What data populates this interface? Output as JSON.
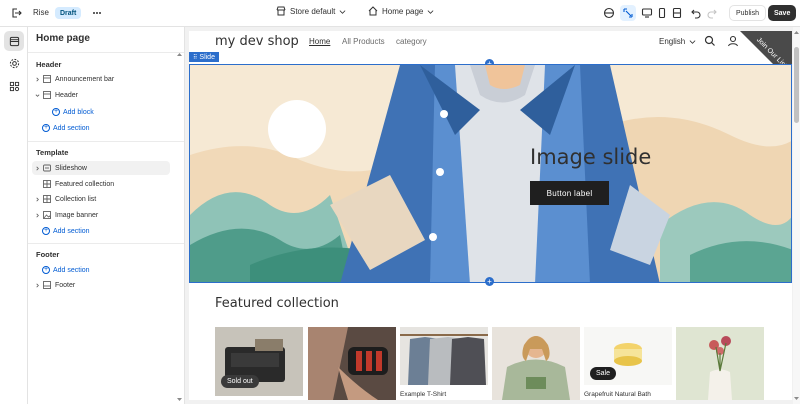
{
  "topbar": {
    "exit_icon": "exit-icon",
    "theme_name": "Rise",
    "status_badge": "Draft",
    "more_icon": "more-horizontal-icon",
    "store_selector": "Store default",
    "page_selector": "Home page",
    "publish_label": "Publish",
    "save_label": "Save"
  },
  "sidebar": {
    "title": "Home page",
    "header_section": "Header",
    "header_items": [
      "Announcement bar",
      "Header"
    ],
    "add_block": "Add block",
    "add_section": "Add section",
    "template_section": "Template",
    "template_items": [
      "Slideshow",
      "Featured collection",
      "Collection list",
      "Image banner"
    ],
    "footer_section": "Footer",
    "footer_items": [
      "Footer"
    ]
  },
  "store": {
    "logo": "my dev shop",
    "nav": [
      "Home",
      "All Products",
      "category"
    ],
    "language": "English",
    "ribbon": "Join Our List!",
    "slide_tag": "Slide",
    "slide_heading": "Image slide",
    "slide_button": "Button label",
    "featured_title": "Featured collection",
    "products": [
      {
        "badge": "Sold out",
        "caption": ""
      },
      {
        "badge": "",
        "caption": ""
      },
      {
        "badge": "",
        "caption": "Example T-Shirt"
      },
      {
        "badge": "",
        "caption": ""
      },
      {
        "badge": "Sale",
        "caption": "Grapefruit Natural Bath"
      },
      {
        "badge": "",
        "caption": ""
      }
    ]
  },
  "colors": {
    "accent_blue": "#005bd3",
    "save_bg": "#303030",
    "draft_badge_bg": "#d5ebff",
    "selection_blue": "#2c6ecb"
  }
}
